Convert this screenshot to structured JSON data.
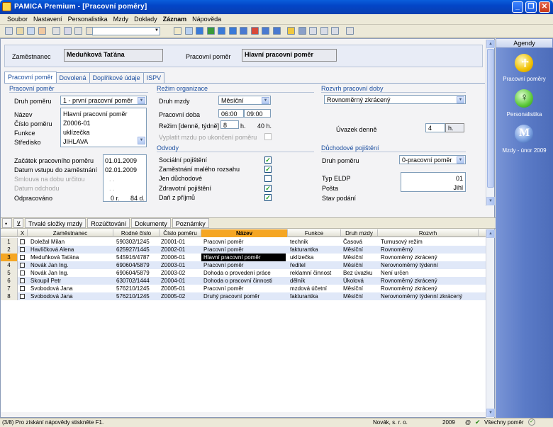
{
  "window": {
    "title": "PAMICA Premium - [Pracovní poměry]"
  },
  "menu": [
    "Soubor",
    "Nastavení",
    "Personalistika",
    "Mzdy",
    "Doklady",
    "Záznam",
    "Nápověda"
  ],
  "header": {
    "employee_label": "Zaměstnanec",
    "employee_value": "Meduňková Taťána",
    "relation_label": "Pracovní poměr",
    "relation_value": "Hlavní pracovní poměr"
  },
  "tabs": [
    "Pracovní poměr",
    "Dovolená",
    "Doplňkové údaje",
    "ISPV"
  ],
  "pp": {
    "group": "Pracovní poměr",
    "druh_label": "Druh poměru",
    "druh_value": "1 - první pracovní poměr",
    "nazev_label": "Název",
    "nazev_value": "Hlavní pracovní poměr",
    "cislo_label": "Číslo poměru",
    "cislo_value": "Z0006-01",
    "funkce_label": "Funkce",
    "funkce_value": "uklízečka",
    "stredisko_label": "Středisko",
    "stredisko_value": "JIHLAVA",
    "zacatek_label": "Začátek pracovního poměru",
    "zacatek_value": "01.01.2009",
    "vstup_label": "Datum vstupu do zaměstnání",
    "vstup_value": "02.01.2009",
    "smlouva_label": "Smlouva na dobu určitou",
    "smlouva_value": ". .",
    "odchod_label": "Datum odchodu",
    "odchod_value": ". .",
    "odpracovano_label": "Odpracováno",
    "odpracovano_r": "0 r.",
    "odpracovano_d": "84 d."
  },
  "rezim": {
    "group": "Režim organizace",
    "mzdy_label": "Druh mzdy",
    "mzdy_value": "Měsíční",
    "doba_label": "Pracovní doba",
    "doba_od": "06:00",
    "doba_do": "09:00",
    "rezim_label": "Režim [denně, týdně]",
    "rezim_d": "8",
    "rezim_d_unit": "h.",
    "rezim_t": "40 h.",
    "vyplatit_label": "Vyplatit mzdu po ukončení poměru"
  },
  "odvody": {
    "group": "Odvody",
    "items": [
      {
        "label": "Sociální pojištění",
        "checked": "✓"
      },
      {
        "label": "Zaměstnání malého rozsahu",
        "checked": "✓"
      },
      {
        "label": "Jen důchodové",
        "checked": ""
      },
      {
        "label": "Zdravotní pojištění",
        "checked": "✓"
      },
      {
        "label": "Daň z příjmů",
        "checked": "✓"
      }
    ]
  },
  "rozvrh": {
    "group": "Rozvrh pracovní doby",
    "value": "Rovnoměrný zkrácený",
    "uvazek_label": "Úvazek denně",
    "uvazek_value": "4",
    "uvazek_unit": "h."
  },
  "duchod": {
    "group": "Důchodové pojištění",
    "druh_label": "Druh poměru",
    "druh_value": "0-pracovní poměr",
    "eldp_label": "Typ ELDP",
    "eldp_value": "01",
    "posta_label": "Pošta",
    "posta_value": "Jihl",
    "stav_label": "Stav podání"
  },
  "gridtabs": [
    "Trvalé složky mzdy",
    "Rozúčtování",
    "Dokumenty",
    "Poznámky"
  ],
  "grid": {
    "columns": [
      "X",
      "Zaměstnanec",
      "Rodné číslo",
      "Číslo poměru",
      "Název",
      "Funkce",
      "Druh mzdy",
      "Rozvrh"
    ],
    "rows": [
      {
        "n": "1",
        "name": "Doležal Milan",
        "rc": "590302/1245",
        "cp": "Z0001-01",
        "nazev": "Pracovní poměr",
        "funkce": "technik",
        "mzda": "Časová",
        "rozvrh": "Turnusový režim"
      },
      {
        "n": "2",
        "name": "Havlíčková Alena",
        "rc": "625927/1445",
        "cp": "Z0002-01",
        "nazev": "Pracovní poměr",
        "funkce": "fakturantka",
        "mzda": "Měsíční",
        "rozvrh": "Rovnoměrný"
      },
      {
        "n": "3",
        "name": "Meduňková Taťána",
        "rc": "545916/4787",
        "cp": "Z0006-01",
        "nazev": "Hlavní pracovní poměr",
        "funkce": "uklízečka",
        "mzda": "Měsíční",
        "rozvrh": "Rovnoměrný zkrácený"
      },
      {
        "n": "4",
        "name": "Novák Jan Ing.",
        "rc": "690604/5879",
        "cp": "Z0003-01",
        "nazev": "Pracovní poměr",
        "funkce": "ředitel",
        "mzda": "Měsíční",
        "rozvrh": "Nerovnoměrný týdenní"
      },
      {
        "n": "5",
        "name": "Novák Jan Ing.",
        "rc": "690604/5879",
        "cp": "Z0003-02",
        "nazev": "Dohoda o provedení práce",
        "funkce": "reklamní činnost",
        "mzda": "Bez úvazku",
        "rozvrh": "Není určen"
      },
      {
        "n": "6",
        "name": "Skoupil Petr",
        "rc": "630702/1444",
        "cp": "Z0004-01",
        "nazev": "Dohoda o pracovní činnosti",
        "funkce": "dělník",
        "mzda": "Úkolová",
        "rozvrh": "Rovnoměrný zkrácený"
      },
      {
        "n": "7",
        "name": "Svobodová Jana",
        "rc": "576210/1245",
        "cp": "Z0005-01",
        "nazev": "Pracovní poměr",
        "funkce": "mzdová účetní",
        "mzda": "Měsíční",
        "rozvrh": "Rovnoměrný zkrácený"
      },
      {
        "n": "8",
        "name": "Svobodová Jana",
        "rc": "576210/1245",
        "cp": "Z0005-02",
        "nazev": "Druhý pracovní poměr",
        "funkce": "fakturantka",
        "mzda": "Měsíční",
        "rozvrh": "Nerovnoměrný týdenní zkrácený"
      }
    ]
  },
  "status": {
    "left": "(3/8) Pro získání nápovědy stiskněte F1.",
    "company": "Novák, s. r. o.",
    "year": "2009",
    "at": "@",
    "filter": "Všechny poměr"
  },
  "agenda": {
    "title": "Agendy",
    "items": [
      "Pracovní poměry",
      "Personalistika",
      "Mzdy - únor 2009"
    ]
  }
}
